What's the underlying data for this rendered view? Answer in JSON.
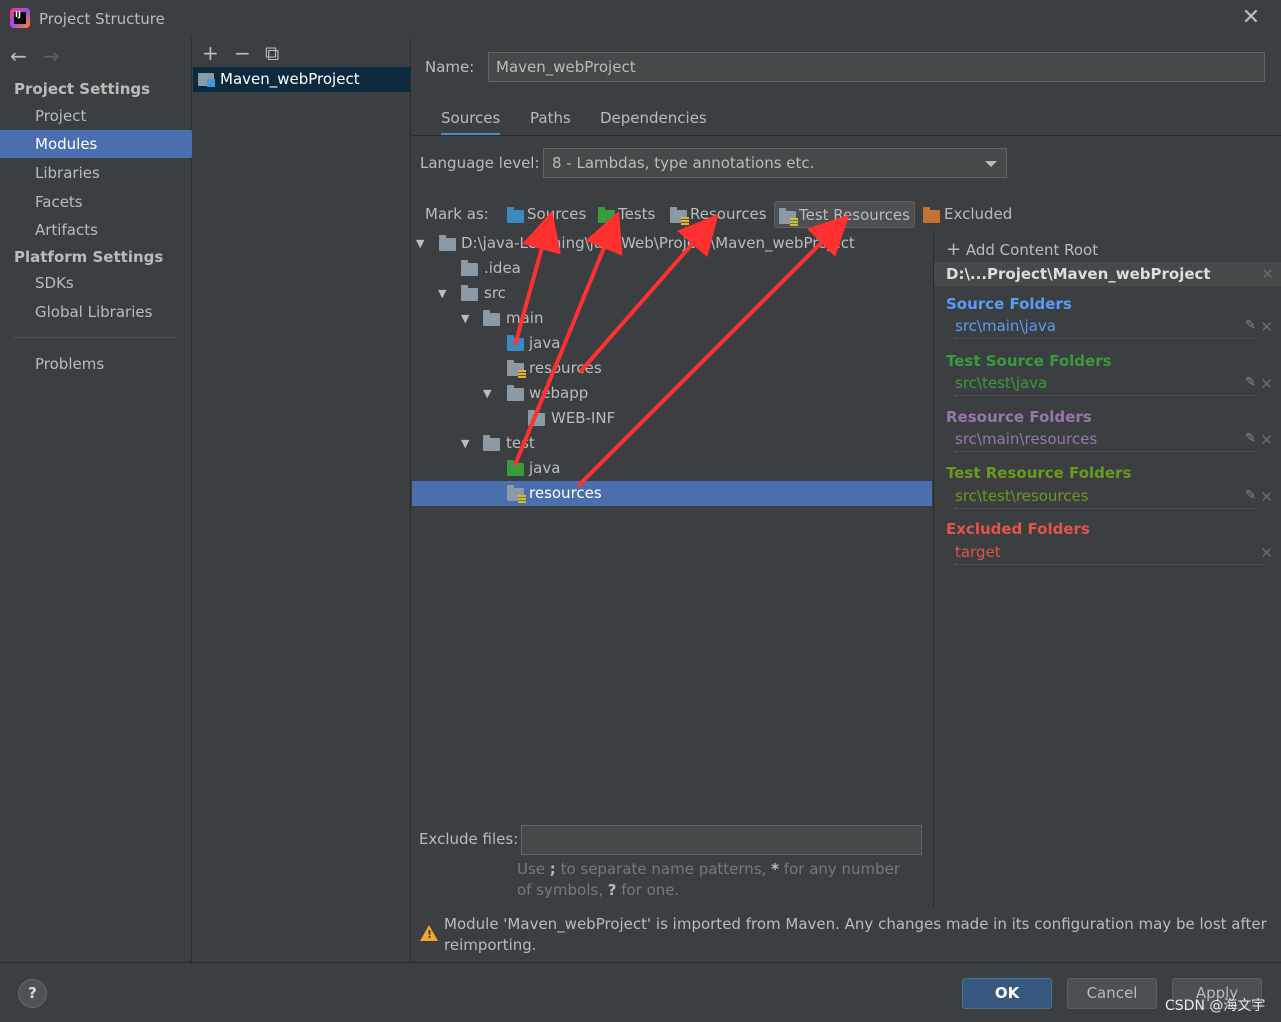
{
  "window": {
    "title": "Project Structure",
    "close": "✕"
  },
  "nav": {
    "back": "←",
    "forward": "→",
    "project_settings": "Project Settings",
    "platform_settings": "Platform Settings",
    "items": [
      "Project",
      "Modules",
      "Libraries",
      "Facets",
      "Artifacts"
    ],
    "platform_items": [
      "SDKs",
      "Global Libraries"
    ],
    "problems": "Problems",
    "active": "Modules"
  },
  "modules": {
    "add": "+",
    "remove": "−",
    "copy": "⧉",
    "items": [
      "Maven_webProject"
    ]
  },
  "main": {
    "name_label": "Name:",
    "name_value": "Maven_webProject",
    "tabs": [
      "Sources",
      "Paths",
      "Dependencies"
    ],
    "active_tab": "Sources",
    "language_label": "Language level:",
    "language_value": "8 - Lambdas, type annotations etc.",
    "mark_as_label": "Mark as:",
    "mark_buttons": [
      "Sources",
      "Tests",
      "Resources",
      "Test Resources",
      "Excluded"
    ],
    "tree": [
      {
        "label": "D:\\java-Learning\\javaWeb\\Project\\Maven_webProject",
        "arrow": "▼"
      },
      {
        "label": ".idea",
        "arrow": ""
      },
      {
        "label": "src",
        "arrow": "▼"
      },
      {
        "label": "main",
        "arrow": "▼"
      },
      {
        "label": "java",
        "arrow": ""
      },
      {
        "label": "resources",
        "arrow": ""
      },
      {
        "label": "webapp",
        "arrow": "▼"
      },
      {
        "label": "WEB-INF",
        "arrow": ""
      },
      {
        "label": "test",
        "arrow": "▼"
      },
      {
        "label": "java",
        "arrow": ""
      },
      {
        "label": "resources",
        "arrow": ""
      }
    ],
    "exclude_label": "Exclude files:",
    "exclude_value": "",
    "exclude_hint_1": "Use ",
    "exclude_hint_sep": ";",
    "exclude_hint_2": " to separate name patterns, ",
    "exclude_hint_star": "*",
    "exclude_hint_3": " for any number of symbols, ",
    "exclude_hint_q": "?",
    "exclude_hint_4": " for one.",
    "warning": "Module 'Maven_webProject' is imported from Maven. Any changes made in its configuration may be lost after reimporting."
  },
  "roots": {
    "add_label": "Add Content Root",
    "header": "D:\\...Project\\Maven_webProject",
    "groups": [
      {
        "title": "Source Folders",
        "entry": "src\\main\\java",
        "color": "#589df6"
      },
      {
        "title": "Test Source Folders",
        "entry": "src\\test\\java",
        "color": "#3b9a3b"
      },
      {
        "title": "Resource Folders",
        "entry": "src\\main\\resources",
        "color": "#9876aa"
      },
      {
        "title": "Test Resource Folders",
        "entry": "src\\test\\resources",
        "color": "#6a9b1a"
      },
      {
        "title": "Excluded Folders",
        "entry": "target",
        "color": "#e5534b"
      }
    ]
  },
  "footer": {
    "help": "?",
    "ok": "OK",
    "cancel": "Cancel",
    "apply": "Apply",
    "watermark": "CSDN @海文宇"
  },
  "colors": {
    "accent": "#4b6eaf",
    "annotation": "#ff3030"
  }
}
